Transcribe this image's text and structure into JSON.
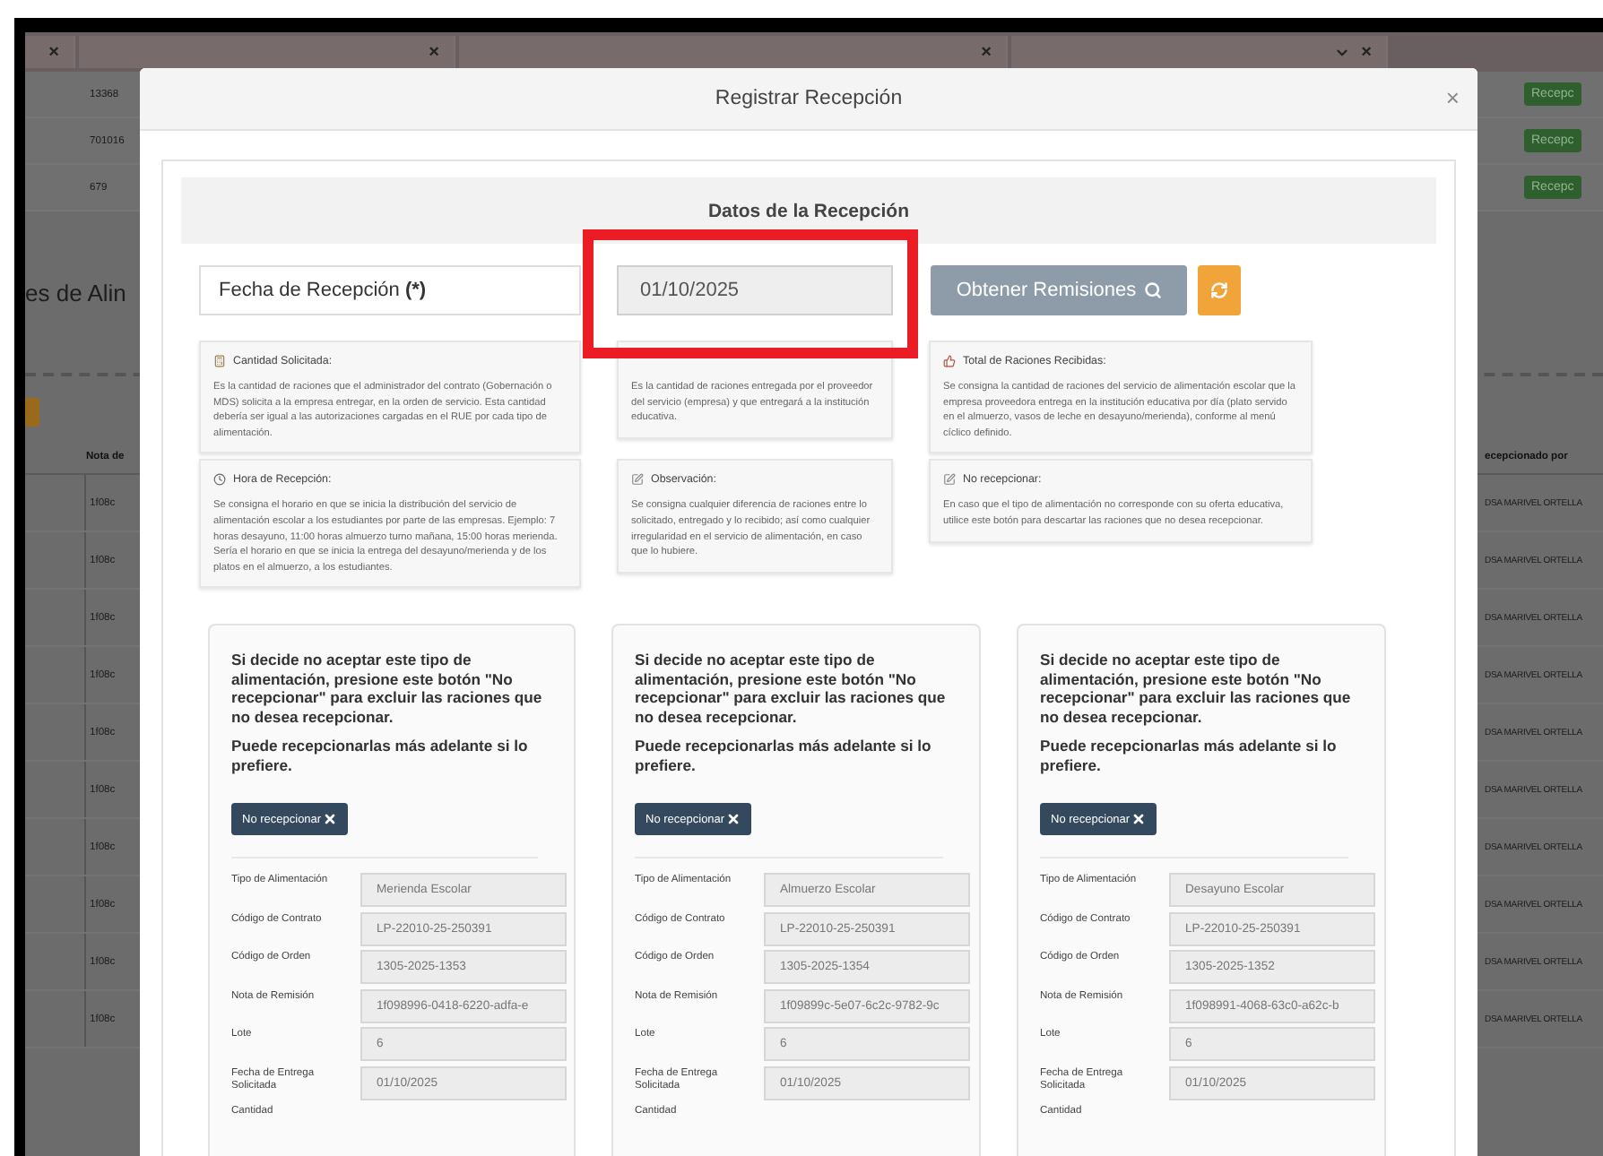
{
  "background_page": {
    "filters": [
      {
        "kind": "clear",
        "clear": "×"
      },
      {
        "kind": "clear",
        "clear": "×"
      },
      {
        "kind": "clear",
        "clear": "×"
      },
      {
        "kind": "select",
        "clear": "×"
      }
    ],
    "top_rows": [
      {
        "column_1": "13368",
        "action": "Recepc"
      },
      {
        "column_1": "701016",
        "action": "Recepc"
      },
      {
        "column_1": "679",
        "action": "Recepc"
      }
    ],
    "heading": "es de Alin",
    "table": {
      "columns": [
        "Nota de",
        "ecepcionado por"
      ],
      "rows": [
        {
          "column_1": "1f08c",
          "column_2": "DSA MARIVEL ORTELLA"
        },
        {
          "column_1": "1f08c",
          "column_2": "DSA MARIVEL ORTELLA"
        },
        {
          "column_1": "1f08c",
          "column_2": "DSA MARIVEL ORTELLA"
        },
        {
          "column_1": "1f08c",
          "column_2": "DSA MARIVEL ORTELLA"
        },
        {
          "column_1": "1f08c",
          "column_2": "DSA MARIVEL ORTELLA"
        },
        {
          "column_1": "1f08c",
          "column_2": "DSA MARIVEL ORTELLA"
        },
        {
          "column_1": "1f08c",
          "column_2": "DSA MARIVEL ORTELLA"
        },
        {
          "column_1": "1f08c",
          "column_2": "DSA MARIVEL ORTELLA"
        },
        {
          "column_1": "1f08c",
          "column_2": "DSA MARIVEL ORTELLA"
        },
        {
          "column_1": "1f08c",
          "column_2": "DSA MARIVEL ORTELLA"
        }
      ]
    }
  },
  "modal": {
    "title": "Registrar Recepción",
    "close": "×",
    "section_title": "Datos de la Recepción",
    "date_label": "Fecha de Recepción **(*)**",
    "date_value": "01/10/2025",
    "fetch_button": "Obtener Remisiones",
    "help_cards": [
      {
        "kind": "calculator",
        "title": "Cantidad Solicitada:",
        "text": "Es la cantidad de raciones que el administrador del contrato (Gobernación o MDS) solicita a la empresa entregar, en la orden de servicio. Esta cantidad debería ser igual a las autorizaciones cargadas en el RUE por cada tipo de alimentación."
      },
      {
        "text": "Es la cantidad de raciones entregada por el proveedor del servicio (empresa) y que entregará a la institución educativa."
      },
      {
        "kind": "thumbs-up",
        "title": "Total de Raciones Recibidas:",
        "text": "Se consigna la cantidad de raciones del servicio de alimentación escolar que la empresa proveedora entrega en la institución educativa por día (plato servido en el almuerzo, vasos de leche en desayuno/merienda), conforme al menú cíclico definido."
      },
      {
        "kind": "clock",
        "title": "Hora de Recepción:",
        "text": "Se consigna el horario en que se inicia la distribución del servicio de alimentación escolar a los estudiantes por parte de las empresas. Ejemplo: 7 horas desayuno, 11:00 horas almuerzo turno mañana, 15:00 horas merienda. Sería el horario en que se inicia la entrega del desayuno/merienda y de los platos en el almuerzo, a los estudiantes."
      },
      {
        "kind": "note",
        "title": "Observación:",
        "text": "Se consigna cualquier diferencia de raciones entre lo solicitado, entregado y lo recibido; así como cualquier irregularidad en el servicio de alimentación, en caso que lo hubiere."
      },
      {
        "kind": "note",
        "title": "No recepcionar:",
        "text": "En caso que el tipo de alimentación no corresponde con su oferta educativa, utilice este botón para descartar las raciones que no desea recepcionar."
      }
    ],
    "meal_cards": [
      {
        "warning": "Si decide no aceptar este tipo de alimentación, presione este botón \"No recepcionar\" para excluir las raciones que no desea recepcionar.",
        "note": "Puede recepcionarlas más adelante si lo prefiere.",
        "button": "No recepcionar",
        "fields": [
          {
            "label": "Tipo de Alimentación",
            "value": "Merienda Escolar"
          },
          {
            "label": "Código de Contrato",
            "value": "LP-22010-25-250391"
          },
          {
            "label": "Código de Orden",
            "value": "1305-2025-1353"
          },
          {
            "label": "Nota de Remisión",
            "value": "1f098996-0418-6220-adfa-e"
          },
          {
            "label": "Lote",
            "value": "6"
          },
          {
            "label": "Fecha de Entrega Solicitada",
            "value": "01/10/2025"
          },
          {
            "label": "Cantidad"
          }
        ]
      },
      {
        "warning": "Si decide no aceptar este tipo de alimentación, presione este botón \"No recepcionar\" para excluir las raciones que no desea recepcionar.",
        "note": "Puede recepcionarlas más adelante si lo prefiere.",
        "button": "No recepcionar",
        "fields": [
          {
            "label": "Tipo de Alimentación",
            "value": "Almuerzo Escolar"
          },
          {
            "label": "Código de Contrato",
            "value": "LP-22010-25-250391"
          },
          {
            "label": "Código de Orden",
            "value": "1305-2025-1354"
          },
          {
            "label": "Nota de Remisión",
            "value": "1f09899c-5e07-6c2c-9782-9c"
          },
          {
            "label": "Lote",
            "value": "6"
          },
          {
            "label": "Fecha de Entrega Solicitada",
            "value": "01/10/2025"
          },
          {
            "label": "Cantidad"
          }
        ]
      },
      {
        "warning": "Si decide no aceptar este tipo de alimentación, presione este botón \"No recepcionar\" para excluir las raciones que no desea recepcionar.",
        "note": "Puede recepcionarlas más adelante si lo prefiere.",
        "button": "No recepcionar",
        "fields": [
          {
            "label": "Tipo de Alimentación",
            "value": "Desayuno Escolar"
          },
          {
            "label": "Código de Contrato",
            "value": "LP-22010-25-250391"
          },
          {
            "label": "Código de Orden",
            "value": "1305-2025-1352"
          },
          {
            "label": "Nota de Remisión",
            "value": "1f098991-4068-63c0-a62c-b"
          },
          {
            "label": "Lote",
            "value": "6"
          },
          {
            "label": "Fecha de Entrega Solicitada",
            "value": "01/10/2025"
          },
          {
            "label": "Cantidad"
          }
        ]
      }
    ]
  },
  "highlight": {
    "kind": "rectangle"
  }
}
